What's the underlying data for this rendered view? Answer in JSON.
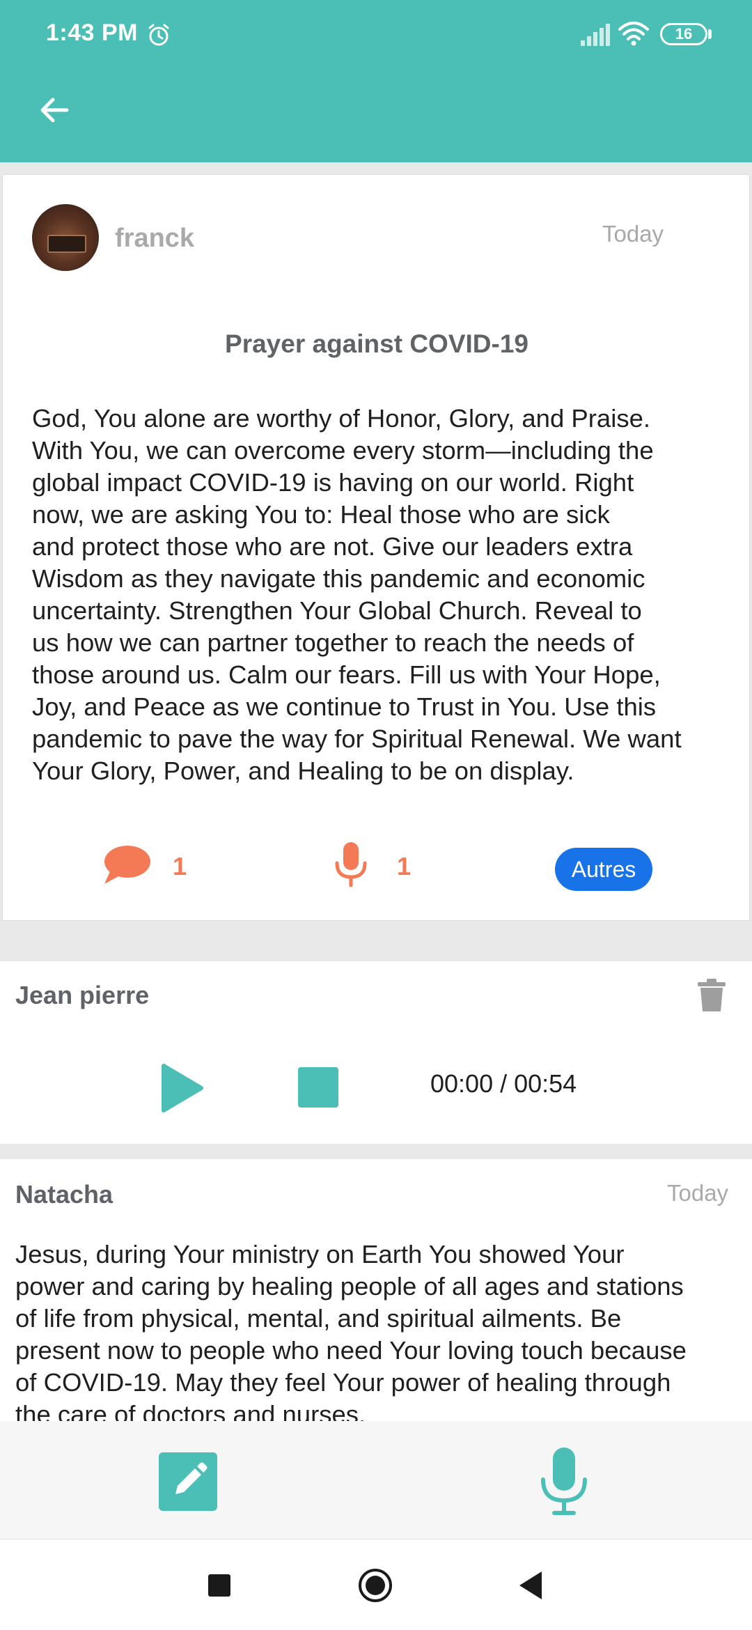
{
  "status_bar": {
    "time": "1:43 PM",
    "battery": "16",
    "icons": [
      "alarm-icon",
      "signal-icon",
      "wifi-icon",
      "battery-icon"
    ]
  },
  "header": {
    "back_icon": "arrow-left-icon",
    "color": "#4bbfb5"
  },
  "post": {
    "author": "franck",
    "date": "Today",
    "title": "Prayer against COVID-19",
    "lines": [
      "God, You alone are worthy of Honor, Glory, and Praise.",
      "With You, we can overcome every storm—including the",
      "global impact COVID-19 is having on our world. Right",
      "now, we are asking You to:  Heal those who are sick",
      "and protect those who are not.  Give our leaders extra",
      "Wisdom as they navigate this pandemic and economic",
      "uncertainty.  Strengthen Your Global Church. Reveal to",
      "us how we can partner together to reach the needs of",
      "those around us.  Calm our fears. Fill us with Your Hope,",
      "Joy, and Peace as we continue to Trust in You.  Use this",
      "pandemic to pave the way for Spiritual Renewal. We want",
      "Your Glory, Power, and Healing to be on display."
    ],
    "comment_count": "1",
    "audio_count": "1",
    "category_label": "Autres",
    "accent_color": "#f47a56",
    "category_color": "#1873e8"
  },
  "audio_reply": {
    "author": "Jean pierre",
    "progress": "00:00 / 00:54"
  },
  "text_reply": {
    "author": "Natacha",
    "date": "Today",
    "lines": [
      "Jesus, during Your ministry on Earth You showed Your",
      "power and caring by healing people of all ages and stations",
      "of life from physical, mental, and spiritual ailments. Be",
      "present now to people who need Your loving touch because",
      "of COVID-19. May they feel Your power of healing through",
      "the care of doctors and nurses."
    ]
  },
  "bottom_bar": {
    "icons": [
      "pencil-icon",
      "microphone-icon"
    ]
  },
  "nav_bar": {
    "icons": [
      "recents-square-icon",
      "home-circle-icon",
      "back-triangle-icon"
    ]
  }
}
